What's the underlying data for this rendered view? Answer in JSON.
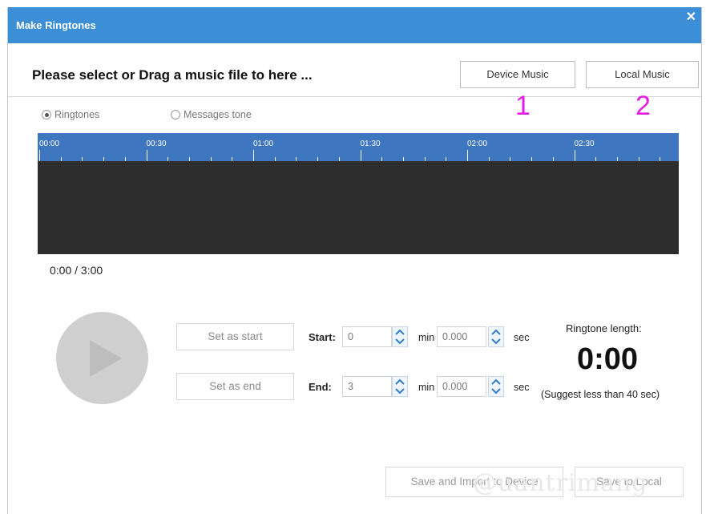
{
  "window": {
    "title": "Make Ringtones",
    "close_glyph": "✕",
    "accent": "#3c8fd6"
  },
  "header": {
    "heading": "Please select or Drag a music file to here ...",
    "device_music_label": "Device Music",
    "local_music_label": "Local Music",
    "annotation_1": "1",
    "annotation_2": "2",
    "annotation_color": "#e11ee1"
  },
  "mode": {
    "ringtones_label": "Ringtones",
    "messages_label": "Messages tone",
    "selected": "Ringtones"
  },
  "timeline": {
    "labels": [
      "00:00",
      "00:30",
      "01:00",
      "01:30",
      "02:00",
      "02:30"
    ],
    "total_seconds": 180,
    "bar_color": "#3e77c0",
    "wave_color": "#2d2d2d"
  },
  "position_text": "0:00 / 3:00",
  "controls": {
    "play_icon": "play-icon",
    "set_start_label": "Set as start",
    "set_end_label": "Set as end",
    "start_label": "Start:",
    "end_label": "End:",
    "start_min": "0",
    "start_sec": "0.000",
    "end_min": "3",
    "end_sec": "0.000",
    "min_unit": "min",
    "sec_unit": "sec"
  },
  "ringtone": {
    "length_label": "Ringtone length:",
    "length_value": "0:00",
    "hint": "(Suggest less than 40 sec)"
  },
  "footer": {
    "save_import_label": "Save and Import to Device",
    "save_local_label": "Save to Local"
  },
  "watermark": "@uantrimang"
}
